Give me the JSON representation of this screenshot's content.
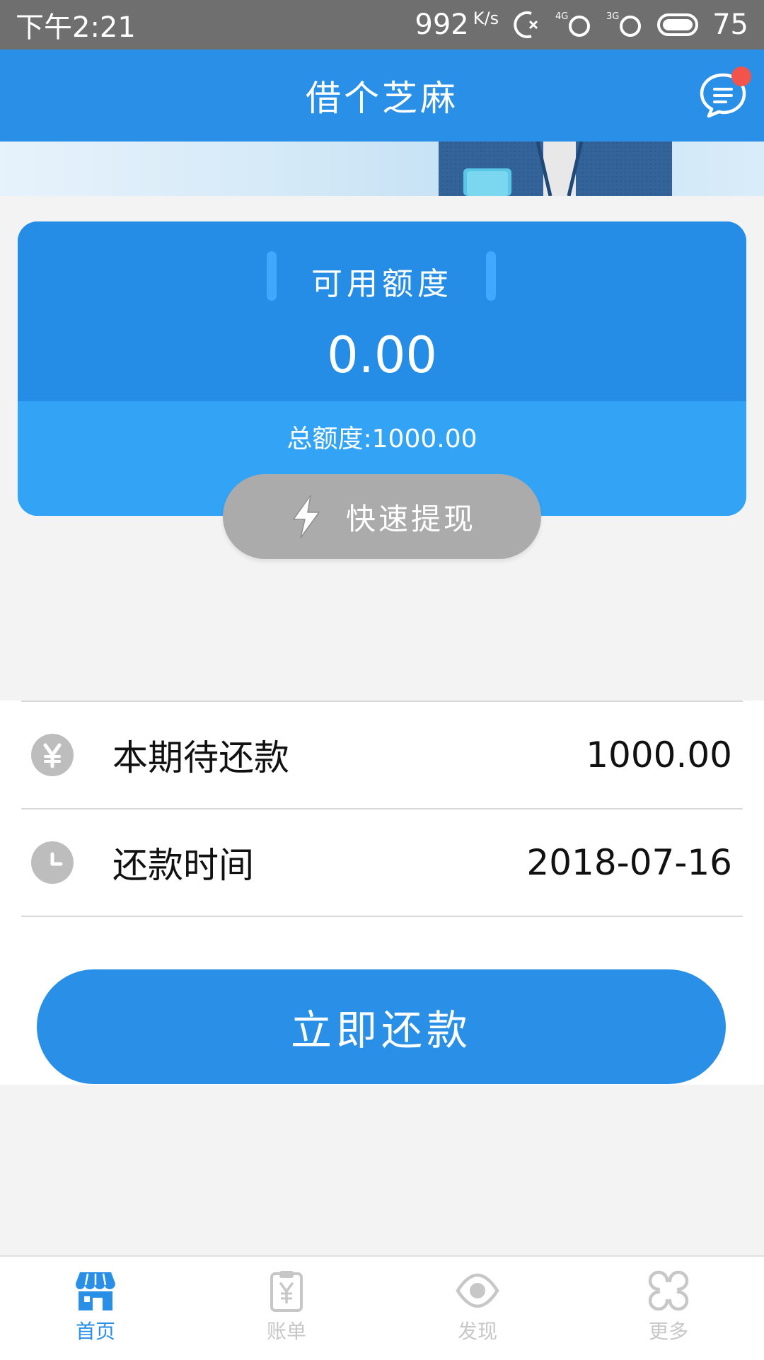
{
  "status_bar": {
    "time": "下午2:21",
    "net_speed": "992",
    "net_unit": "K/s",
    "sig1": "4G",
    "sig2": "3G",
    "battery": "75"
  },
  "header": {
    "title": "借个芝麻",
    "message_icon": "chat-bubble-icon",
    "badge_color": "#f2534a"
  },
  "card": {
    "available_label": "可用额度",
    "available_amount": "0.00",
    "total_quota": "总额度:1000.00",
    "withdraw_label": "快速提现"
  },
  "repayment": {
    "due_label": "本期待还款",
    "due_value": "1000.00",
    "date_label": "还款时间",
    "date_value": "2018-07-16",
    "pay_button": "立即还款"
  },
  "bottom_nav": [
    {
      "label": "首页",
      "icon": "store-icon",
      "active": true
    },
    {
      "label": "账单",
      "icon": "bill-icon",
      "active": false
    },
    {
      "label": "发现",
      "icon": "eye-icon",
      "active": false
    },
    {
      "label": "更多",
      "icon": "more-icon",
      "active": false
    }
  ],
  "colors": {
    "primary": "#2a8fe6",
    "card_bottom": "#33a3f6",
    "inactive": "#c7c7c7",
    "withdraw_button": "#ababab"
  }
}
